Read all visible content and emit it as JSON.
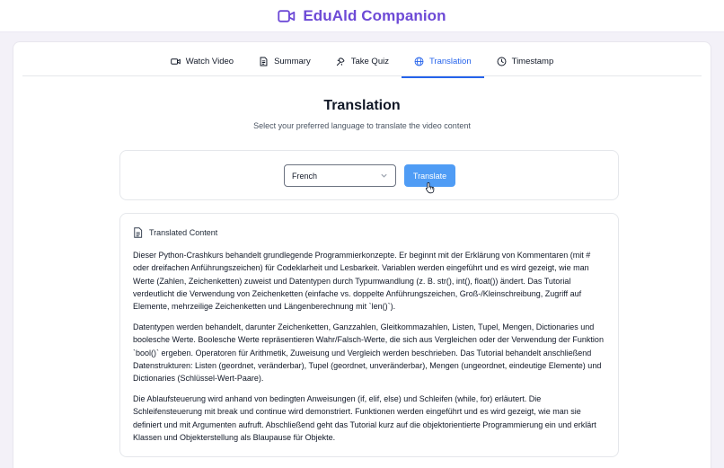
{
  "app": {
    "title": "EduAld Companion",
    "accent_color": "#6d4ad6",
    "brand_icon": "video-camera-icon"
  },
  "tabs": [
    {
      "label": "Watch Video",
      "icon": "video-icon",
      "active": false
    },
    {
      "label": "Summary",
      "icon": "document-icon",
      "active": false
    },
    {
      "label": "Take Quiz",
      "icon": "quiz-icon",
      "active": false
    },
    {
      "label": "Translation",
      "icon": "globe-icon",
      "active": true
    },
    {
      "label": "Timestamp",
      "icon": "clock-icon",
      "active": false
    }
  ],
  "translation": {
    "title": "Translation",
    "subtitle": "Select your preferred language to translate the video content",
    "selected_language": "French",
    "translate_button": "Translate",
    "button_color": "#4f9cf5",
    "active_tab_color": "#2563eb"
  },
  "content": {
    "heading": "Translated Content",
    "paragraphs": [
      "Dieser Python-Crashkurs behandelt grundlegende Programmierkonzepte. Er beginnt mit der Erklärung von Kommentaren (mit # oder dreifachen Anführungszeichen) für Codeklarheit und Lesbarkeit. Variablen werden eingeführt und es wird gezeigt, wie man Werte (Zahlen, Zeichenketten) zuweist und Datentypen durch Typumwandlung (z. B. str(), int(), float()) ändert. Das Tutorial verdeutlicht die Verwendung von Zeichenketten (einfache vs. doppelte Anführungszeichen, Groß-/Kleinschreibung, Zugriff auf Elemente, mehrzeilige Zeichenketten und Längenberechnung mit `len()`).",
      "Datentypen werden behandelt, darunter Zeichenketten, Ganzzahlen, Gleitkommazahlen, Listen, Tupel, Mengen, Dictionaries und boolesche Werte. Boolesche Werte repräsentieren Wahr/Falsch-Werte, die sich aus Vergleichen oder der Verwendung der Funktion `bool()` ergeben. Operatoren für Arithmetik, Zuweisung und Vergleich werden beschrieben. Das Tutorial behandelt anschließend Datenstrukturen: Listen (geordnet, veränderbar), Tupel (geordnet, unveränderbar), Mengen (ungeordnet, eindeutige Elemente) und Dictionaries (Schlüssel-Wert-Paare).",
      "Die Ablaufsteuerung wird anhand von bedingten Anweisungen (if, elif, else) und Schleifen (while, for) erläutert. Die Schleifensteuerung mit break und continue wird demonstriert. Funktionen werden eingeführt und es wird gezeigt, wie man sie definiert und mit Argumenten aufruft. Abschließend geht das Tutorial kurz auf die objektorientierte Programmierung ein und erklärt Klassen und Objekterstellung als Blaupause für Objekte."
    ]
  }
}
